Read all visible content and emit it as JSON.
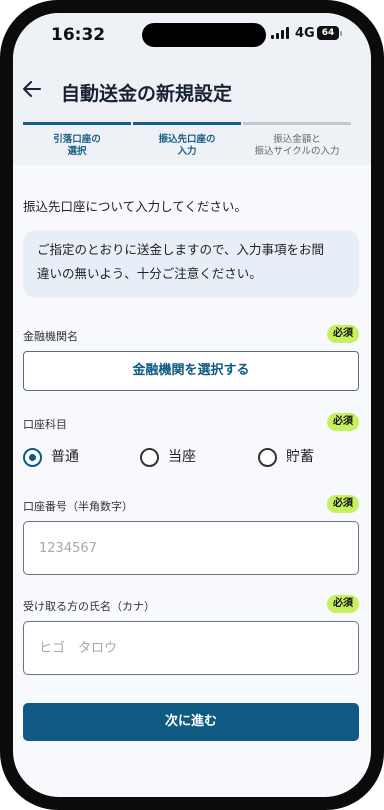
{
  "status_bar": {
    "time": "16:32",
    "network": "4G",
    "battery": "64"
  },
  "header": {
    "title": "自動送金の新規設定"
  },
  "steps": [
    {
      "line1": "引落口座の",
      "line2": "選択",
      "state": "done"
    },
    {
      "line1": "振込先口座の",
      "line2": "入力",
      "state": "current"
    },
    {
      "line1": "振込金額と",
      "line2": "振込サイクルの入力",
      "state": "upcoming"
    }
  ],
  "intro": "振込先口座について入力してください。",
  "notice": {
    "line1": "ご指定のとおりに送金しますので、入力事項をお間",
    "line2": "違いの無いよう、十分ご注意ください。"
  },
  "required_label": "必須",
  "bank": {
    "label": "金融機関名",
    "button": "金融機関を選択する"
  },
  "account_type": {
    "label": "口座科目",
    "options": [
      "普通",
      "当座",
      "貯蓄"
    ],
    "selected": "普通"
  },
  "account_number": {
    "label": "口座番号（半角数字）",
    "placeholder": "1234567"
  },
  "recipient": {
    "label": "受け取る方の氏名（カナ）",
    "placeholder": "ヒゴ　タロウ"
  },
  "next_button": "次に進む",
  "colors": {
    "primary": "#0f5a82",
    "required_badge": "#c7f05f",
    "step_active": "#1a5d84",
    "step_inactive": "#c3c8ce"
  },
  "icons": {
    "back": "arrow-left-icon"
  }
}
